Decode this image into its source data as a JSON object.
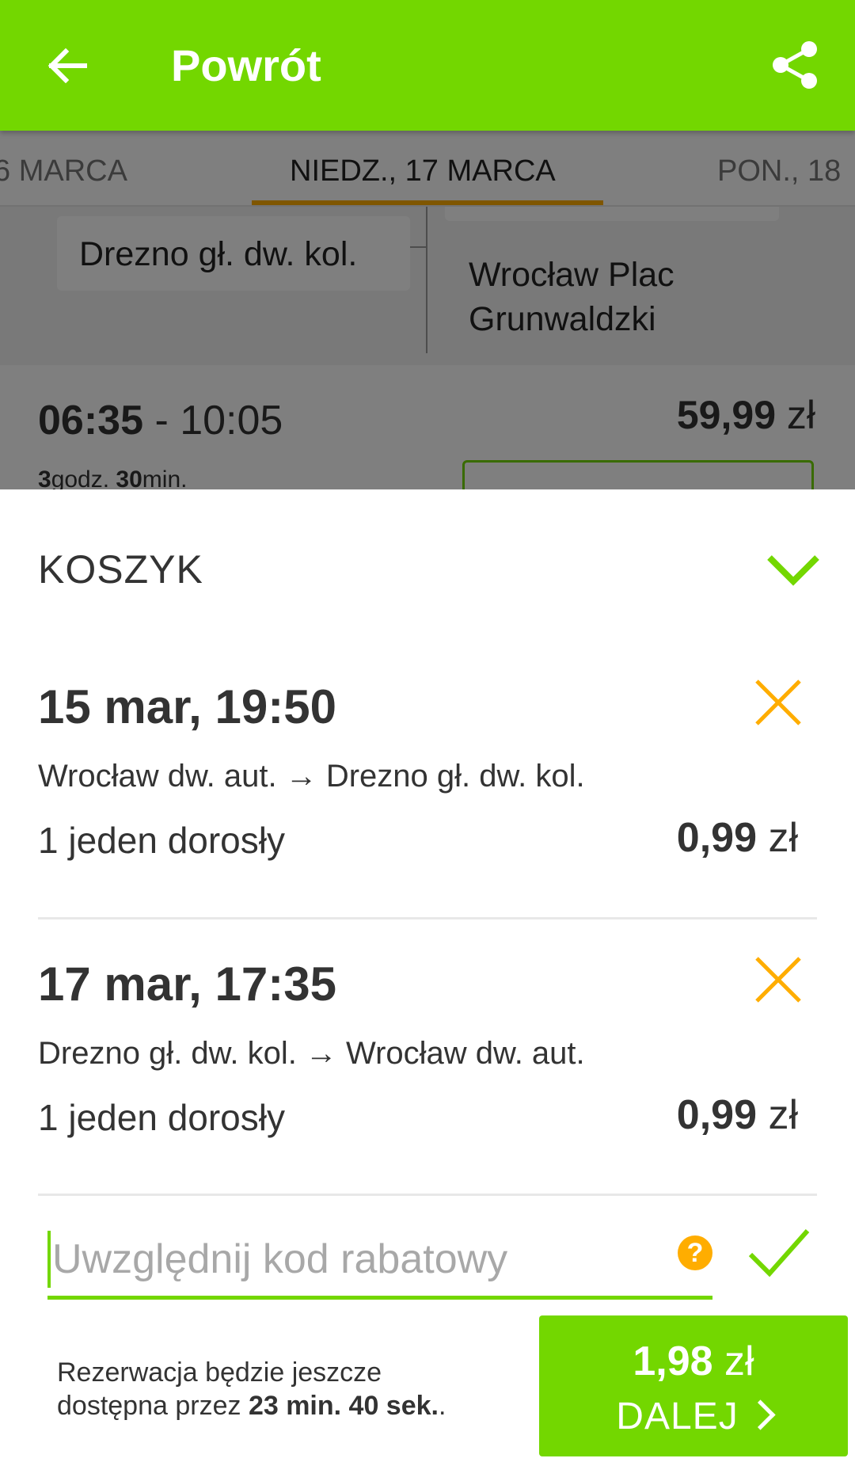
{
  "appbar": {
    "title": "Powrót",
    "back_icon": "arrow-left-icon",
    "share_icon": "share-icon",
    "color": "#73d700"
  },
  "date_tabs": {
    "prev": "6 MARCA",
    "active": "NIEDZ., 17 MARCA",
    "next": "PON., 18",
    "indicator_color": "#ffad00"
  },
  "stations": {
    "from": "Drezno gł. dw. kol.",
    "to": "Wrocław Plac Grunwaldzki"
  },
  "result": {
    "departure": "06:35",
    "separator": " - ",
    "arrival": "10:05",
    "price_value": "59,99",
    "price_currency": " zł",
    "duration_hours": "3",
    "duration_hours_unit": "godz.",
    "duration_minutes": "30",
    "duration_minutes_unit": "min."
  },
  "cart": {
    "title": "KOSZYK",
    "collapse_icon": "chevron-down-icon",
    "items": [
      {
        "date": "15 mar, 19:50",
        "route": "Wrocław dw. aut. → Drezno gł. dw. kol.",
        "passengers": "1 jeden dorosły",
        "price_value": "0,99",
        "price_currency": " zł",
        "remove_icon": "close-icon"
      },
      {
        "date": "17 mar, 17:35",
        "route": "Drezno gł. dw. kol. → Wrocław dw. aut.",
        "passengers": "1 jeden dorosły",
        "price_value": "0,99",
        "price_currency": " zł",
        "remove_icon": "close-icon"
      }
    ],
    "remove_color": "#ffad00"
  },
  "promo": {
    "placeholder": "Uwzględnij kod rabatowy",
    "value": "",
    "help_label": "?",
    "help_icon": "question-icon",
    "apply_icon": "check-icon"
  },
  "footer": {
    "timer_text_1": "Rezerwacja będzie jeszcze",
    "timer_text_2": "dostępna przez ",
    "timer_countdown": "23 min. 40 sek.",
    "timer_suffix": ".",
    "total_value": "1,98",
    "total_currency": " zł",
    "next_label": "DALEJ",
    "next_icon": "chevron-right-icon"
  }
}
